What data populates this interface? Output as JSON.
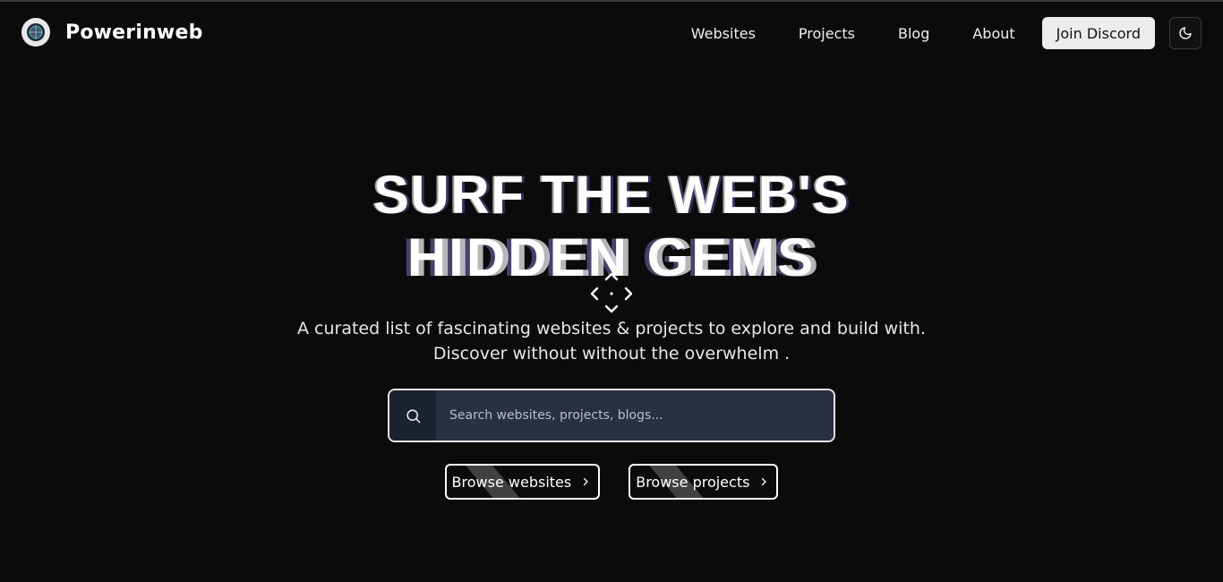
{
  "brand": {
    "name": "Powerinweb",
    "logo_icon": "globe-logo-icon"
  },
  "nav": {
    "links": [
      "Websites",
      "Projects",
      "Blog",
      "About"
    ],
    "cta": "Join Discord",
    "theme_toggle_icon": "moon-icon"
  },
  "hero": {
    "headline_line1": "SURF THE WEB'S",
    "headline_line2": "HIDDEN GEMS",
    "subtitle_line1": "A curated list of fascinating websites & projects to explore and build with.",
    "subtitle_line2": "Discover without without the overwhelm ."
  },
  "search": {
    "placeholder": "Search websites, projects, blogs...",
    "value": "",
    "icon": "search-icon"
  },
  "actions": {
    "browse_websites": "Browse websites",
    "browse_projects": "Browse projects"
  },
  "colors": {
    "background": "#0b0b0c",
    "search_bg": "#283142",
    "discord_bg": "#ececec"
  }
}
